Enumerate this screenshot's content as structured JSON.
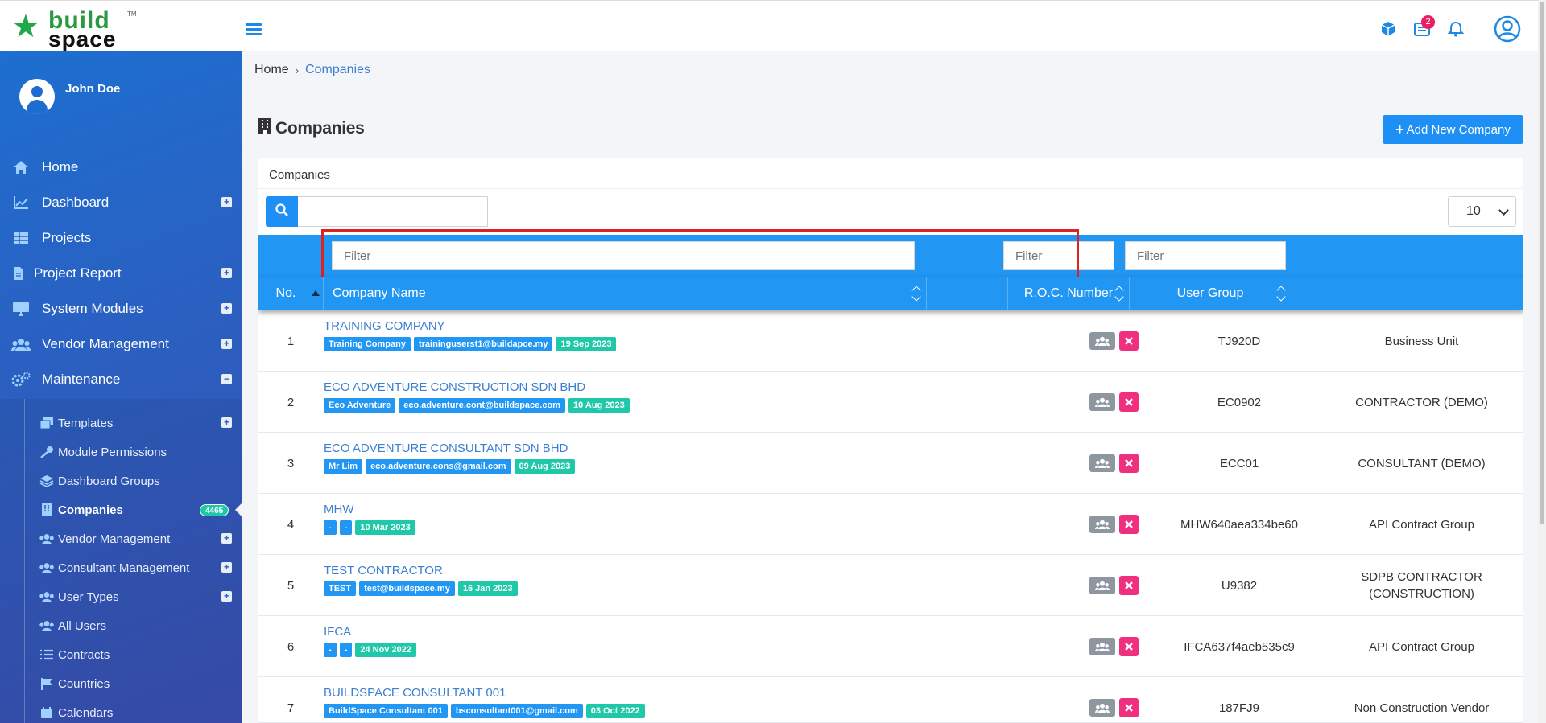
{
  "brand": {
    "word1": "build",
    "word2": "space",
    "tm": "TM"
  },
  "topbar": {
    "notification_count": "2"
  },
  "user": {
    "name": "John Doe"
  },
  "sidebar": {
    "items": [
      {
        "label": "Home",
        "icon": "home-icon"
      },
      {
        "label": "Dashboard",
        "icon": "chart-line-icon",
        "expand": "+"
      },
      {
        "label": "Projects",
        "icon": "grid-icon"
      },
      {
        "label": "Project Report",
        "icon": "file-icon",
        "expand": "+"
      },
      {
        "label": "System Modules",
        "icon": "monitor-icon",
        "expand": "+"
      },
      {
        "label": "Vendor Management",
        "icon": "users-icon",
        "expand": "+"
      },
      {
        "label": "Maintenance",
        "icon": "gears-icon",
        "expand": "−"
      }
    ],
    "subitems": [
      {
        "label": "Templates",
        "icon": "copy-icon",
        "expand": "+"
      },
      {
        "label": "Module Permissions",
        "icon": "key-icon"
      },
      {
        "label": "Dashboard Groups",
        "icon": "layers-icon"
      },
      {
        "label": "Companies",
        "icon": "building-icon",
        "badge": "4465"
      },
      {
        "label": "Vendor Management",
        "icon": "users-icon",
        "expand": "+"
      },
      {
        "label": "Consultant Management",
        "icon": "users-icon",
        "expand": "+"
      },
      {
        "label": "User Types",
        "icon": "users-icon",
        "expand": "+"
      },
      {
        "label": "All Users",
        "icon": "users-icon"
      },
      {
        "label": "Contracts",
        "icon": "list-icon"
      },
      {
        "label": "Countries",
        "icon": "flag-icon"
      },
      {
        "label": "Calendars",
        "icon": "calendar-icon"
      }
    ]
  },
  "breadcrumb": {
    "home": "Home",
    "current": "Companies"
  },
  "page": {
    "title": "Companies",
    "add_button": "Add New Company"
  },
  "card": {
    "title": "Companies",
    "page_size": "10"
  },
  "table": {
    "filter_placeholder": "Filter",
    "columns": {
      "no": "No.",
      "company_name": "Company Name",
      "roc": "R.O.C. Number",
      "user_group": "User Group"
    },
    "rows": [
      {
        "no": "1",
        "name": "TRAINING COMPANY",
        "tag1": "Training Company",
        "tag2": "traininguserst1@buildapce.my",
        "date": "19 Sep 2023",
        "roc": "TJ920D",
        "group": "Business Unit"
      },
      {
        "no": "2",
        "name": "ECO ADVENTURE CONSTRUCTION SDN BHD",
        "tag1": "Eco Adventure",
        "tag2": "eco.adventure.cont@buildspace.com",
        "date": "10 Aug 2023",
        "roc": "EC0902",
        "group": "CONTRACTOR (DEMO)"
      },
      {
        "no": "3",
        "name": "ECO ADVENTURE CONSULTANT SDN BHD",
        "tag1": "Mr Lim",
        "tag2": "eco.adventure.cons@gmail.com",
        "date": "09 Aug 2023",
        "roc": "ECC01",
        "group": "CONSULTANT (DEMO)"
      },
      {
        "no": "4",
        "name": "MHW",
        "tag1": "-",
        "tag2": "-",
        "date": "10 Mar 2023",
        "roc": "MHW640aea334be60",
        "group": "API Contract Group"
      },
      {
        "no": "5",
        "name": "TEST CONTRACTOR",
        "tag1": "TEST",
        "tag2": "test@buildspace.my",
        "date": "16 Jan 2023",
        "roc": "U9382",
        "group": "SDPB CONTRACTOR (CONSTRUCTION)"
      },
      {
        "no": "6",
        "name": "IFCA",
        "tag1": "-",
        "tag2": "-",
        "date": "24 Nov 2022",
        "roc": "IFCA637f4aeb535c9",
        "group": "API Contract Group"
      },
      {
        "no": "7",
        "name": "BUILDSPACE CONSULTANT 001",
        "tag1": "BuildSpace Consultant 001",
        "tag2": "bsconsultant001@gmail.com",
        "date": "03 Oct 2022",
        "roc": "187FJ9",
        "group": "Non Construction Vendor"
      }
    ]
  }
}
